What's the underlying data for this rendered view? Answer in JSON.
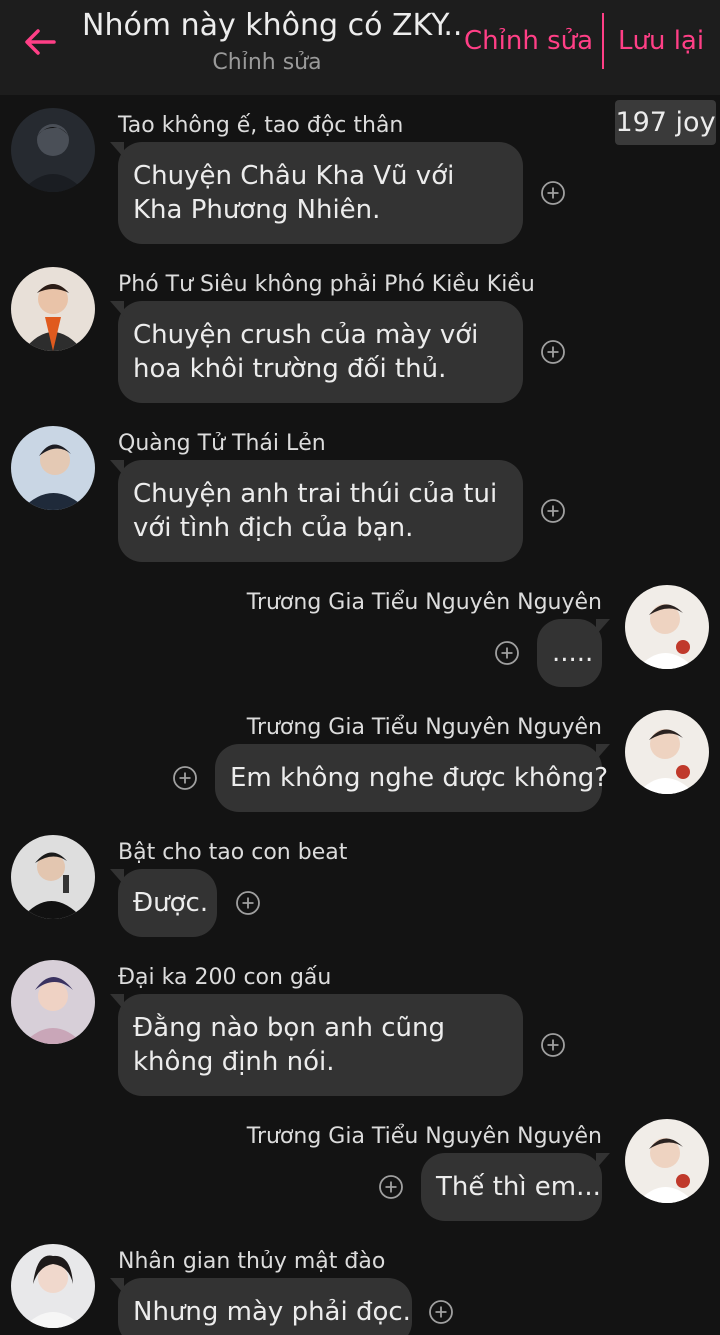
{
  "header": {
    "title": "Nhóm này không có ZKY...",
    "subtitle": "Chỉnh sửa",
    "edit_label": "Chỉnh sửa",
    "save_label": "Lưu lại"
  },
  "joy_badge": "197 joy",
  "colors": {
    "accent": "#ff3f86",
    "background": "#131313",
    "header": "#1d1d1d",
    "bubble": "#333333"
  },
  "icons": {
    "back": "arrow-left-icon",
    "add_reaction": "plus-circle-icon"
  },
  "messages": [
    {
      "side": "left",
      "name": "Tao không ế, tao độc thân",
      "text": "Chuyện Châu Kha Vũ với Kha Phương Nhiên."
    },
    {
      "side": "left",
      "name": "Phó Tư Siêu không phải Phó Kiều Kiều",
      "text": "Chuyện crush của mày với hoa khôi trường đối thủ."
    },
    {
      "side": "left",
      "name": "Quàng Tử Thái Lẻn",
      "text": "Chuyện anh trai thúi của tui với tình địch của bạn."
    },
    {
      "side": "right",
      "name": "Trương Gia Tiểu Nguyên Nguyên",
      "text": "....."
    },
    {
      "side": "right",
      "name": "Trương Gia Tiểu Nguyên Nguyên",
      "text": "Em không nghe được không?"
    },
    {
      "side": "left",
      "name": "Bật cho tao con beat",
      "text": "Được."
    },
    {
      "side": "left",
      "name": "Đại ka 200 con gấu",
      "text": "Đằng nào bọn anh cũng không định nói."
    },
    {
      "side": "right",
      "name": "Trương Gia Tiểu Nguyên Nguyên",
      "text": "Thế thì em..."
    },
    {
      "side": "left",
      "name": "Nhân gian thủy mật đào",
      "text": "Nhưng mày phải đọc."
    }
  ]
}
